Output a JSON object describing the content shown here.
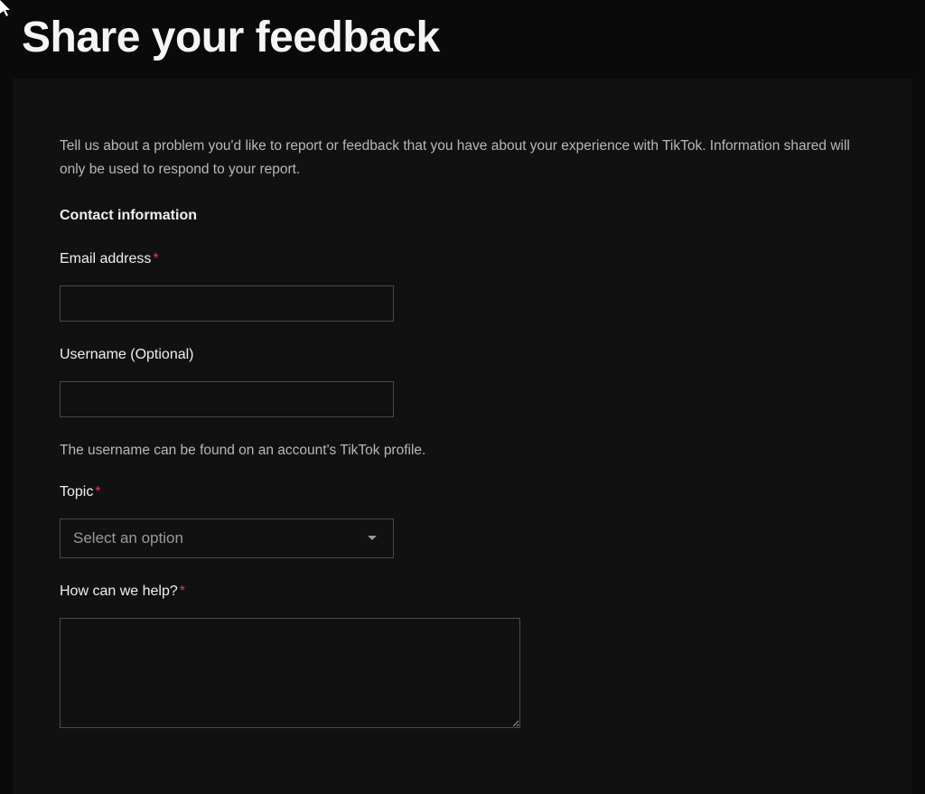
{
  "page": {
    "title": "Share your feedback"
  },
  "form": {
    "intro": "Tell us about a problem you'd like to report or feedback that you have about your experience with TikTok. Information shared will only be used to respond to your report.",
    "section_heading": "Contact information",
    "email": {
      "label": "Email address",
      "value": ""
    },
    "username": {
      "label": "Username (Optional)",
      "value": "",
      "helper": "The username can be found on an account's TikTok profile."
    },
    "topic": {
      "label": "Topic",
      "placeholder": "Select an option"
    },
    "message": {
      "label": "How can we help?",
      "value": ""
    }
  }
}
